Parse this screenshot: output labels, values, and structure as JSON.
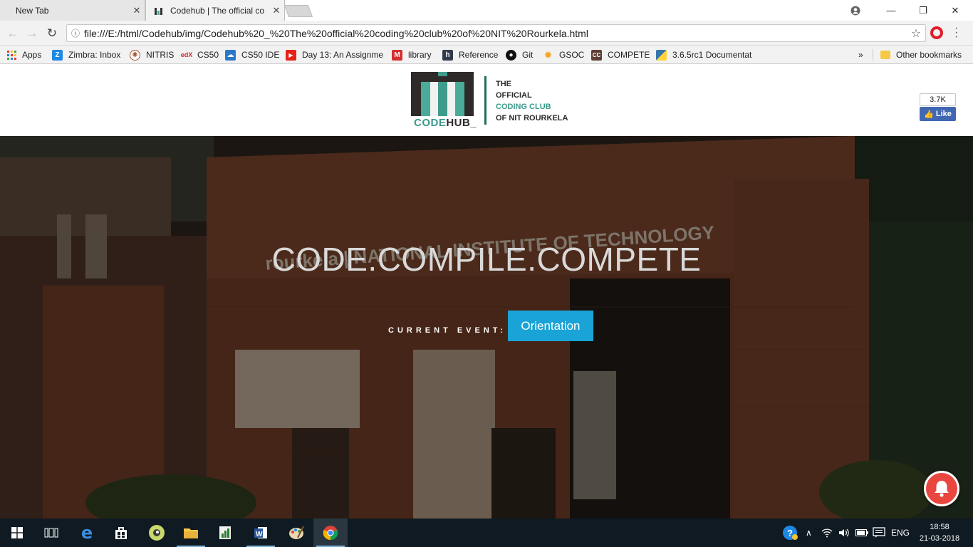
{
  "browser": {
    "tabs": [
      {
        "title": "New Tab",
        "active": false
      },
      {
        "title": "Codehub | The official co",
        "active": true
      }
    ],
    "url": "file:///E:/html/Codehub/img/Codehub%20_%20The%20official%20coding%20club%20of%20NIT%20Rourkela.html",
    "bookmarks": [
      {
        "label": "Apps",
        "icon": "apps-grid-icon"
      },
      {
        "label": "Zimbra: Inbox",
        "icon": "zimbra-icon"
      },
      {
        "label": "NITRIS",
        "icon": "nitris-icon"
      },
      {
        "label": "CS50",
        "icon": "edx-icon"
      },
      {
        "label": "CS50 IDE",
        "icon": "cs50-ide-icon"
      },
      {
        "label": "Day 13: An Assignme",
        "icon": "youtube-icon"
      },
      {
        "label": "library",
        "icon": "m-icon"
      },
      {
        "label": "Reference",
        "icon": "h-icon"
      },
      {
        "label": "Git",
        "icon": "github-icon"
      },
      {
        "label": "GSOC",
        "icon": "sun-icon"
      },
      {
        "label": "COMPETE",
        "icon": "cc-icon"
      },
      {
        "label": "3.6.5rc1 Documentat",
        "icon": "python-icon"
      }
    ],
    "overflow": "»",
    "other_bookmarks": "Other bookmarks"
  },
  "site": {
    "logo_word_a": "CODE",
    "logo_word_b": "HUB_",
    "tagline": [
      "THE",
      "OFFICIAL",
      "CODING CLUB",
      "OF NIT ROURKELA"
    ],
    "fb_count": "3.7K",
    "fb_like": "Like",
    "hero_title": "CODE.COMPILE.COMPETE",
    "event_label": "CURRENT EVENT:",
    "event_button": "Orientation",
    "sign_text": "rourkela | NATIONAL INSTITUTE OF TECHNOLOGY"
  },
  "taskbar": {
    "lang": "ENG",
    "time": "18:58",
    "date": "21-03-2018"
  },
  "colors": {
    "accent_teal": "#4aab9a",
    "event_button": "#1aa3d6",
    "notif_bell": "#e9463f",
    "fb_blue": "#4267b2"
  }
}
